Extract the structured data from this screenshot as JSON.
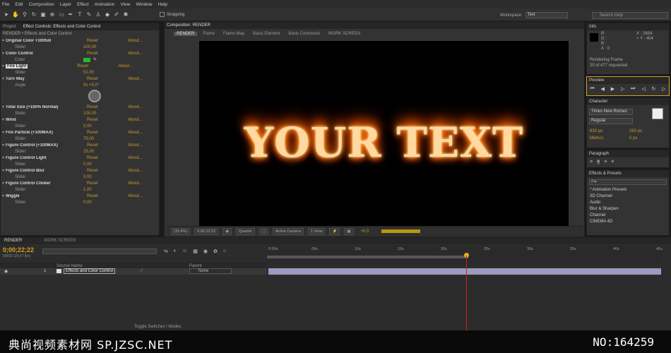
{
  "menu": [
    "File",
    "Edit",
    "Composition",
    "Layer",
    "Effect",
    "Animation",
    "View",
    "Window",
    "Help"
  ],
  "toolbar": {
    "snapping": "Snapping",
    "workspace_label": "Workspace:",
    "workspace_value": "Text",
    "search_placeholder": "Search Help"
  },
  "left_panel": {
    "tabs": [
      "Project",
      "Effect Controls: Effects and Color Control"
    ],
    "breadcrumb": "RENDER • Effects and Color Control",
    "reset": "Reset",
    "about": "About...",
    "effects": [
      {
        "name": "Original Color +100full",
        "sub": "Slider",
        "value": "100,00"
      },
      {
        "name": "Color Control",
        "sub": "Color",
        "value": ""
      },
      {
        "name": "Fire Light",
        "sub": "Slider",
        "value": "51,00"
      },
      {
        "name": "Turn Way",
        "sub": "Angle",
        "value": "0x +0,0°"
      },
      {
        "name": "Total Size (+100% Normal)",
        "sub": "Slider",
        "value": "100,00"
      },
      {
        "name": "Wind",
        "sub": "Slider",
        "value": "0,00"
      },
      {
        "name": "Fire Particle (+100MAX)",
        "sub": "Slider",
        "value": "75,00"
      },
      {
        "name": "Figure Control (+100MAX)",
        "sub": "Slider",
        "value": "25,00"
      },
      {
        "name": "Figure Control Light",
        "sub": "Slider",
        "value": "0,00"
      },
      {
        "name": "Figure Control Blur",
        "sub": "Slider",
        "value": "0,00"
      },
      {
        "name": "Figure Control Choker",
        "sub": "Slider",
        "value": "1,00"
      },
      {
        "name": "Wiggle",
        "sub": "Slider",
        "value": "0,00"
      }
    ]
  },
  "composition": {
    "tab": "Composition: RENDER",
    "flow": [
      "RENDER",
      "Flame",
      "Flame Map",
      "Basic Element",
      "Basic Contoured",
      "WORK SCREEN"
    ],
    "text": "YOUR TEXT",
    "bottom": {
      "zoom": "(33,4%)",
      "time": "0;00;22;22",
      "quality": "Quarter",
      "camera": "Active Camera",
      "views": "1 View",
      "exposure": "+0,0"
    }
  },
  "info": {
    "title": "Info",
    "r": "R :",
    "g": "G :",
    "b": "B :",
    "a": "A : 0",
    "x": "X : 2654",
    "y": "+ Y : 404",
    "status1": "Rendering Frame",
    "status2": "20 of 477 requested"
  },
  "preview": {
    "title": "Preview"
  },
  "character": {
    "title": "Character",
    "font": "Times New Roman",
    "style": "Regular",
    "size": "633 px",
    "leading": "263 px",
    "tracking": "0 px",
    "metrics": "Metrics"
  },
  "paragraph": {
    "title": "Paragraph"
  },
  "effects_presets": {
    "title": "Effects & Presets",
    "search": "ℙ▾",
    "items": [
      "* Animation Presets",
      "3D Channel",
      "Audio",
      "Blur & Sharpen",
      "Channel",
      "CINEMA 4D"
    ]
  },
  "timeline": {
    "tabs": [
      "RENDER",
      "WORK SCREEN"
    ],
    "time": "0;00;22;22",
    "fps": "00682 (29.97 fps)",
    "col_source": "Source Name",
    "col_parent": "Parent",
    "layer_num": "1",
    "layer_name": "Effects and Color Control",
    "parent_value": "None",
    "ruler": [
      "0:00s",
      "05s",
      "10s",
      "15s",
      "20s",
      "25s",
      "30s",
      "35s",
      "40s",
      "45s"
    ],
    "toggle": "Toggle Switches / Modes"
  },
  "watermark": {
    "left": "典尚视频素材网 SP.JZSC.NET",
    "right": "NO:164259"
  }
}
